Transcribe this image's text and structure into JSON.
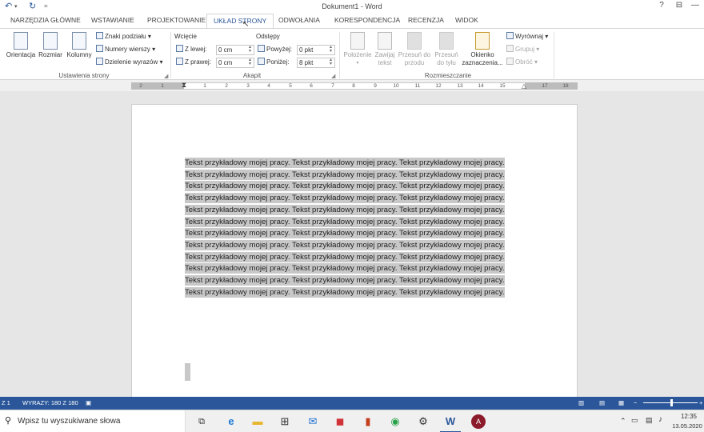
{
  "titlebar": {
    "title": "Dokument1 - Word",
    "undo_icon": "undo-icon",
    "redo_icon": "redo-icon",
    "qat_more": "=",
    "help": "?",
    "ribbon_display": "⊟",
    "minimize": "—"
  },
  "tabs": [
    {
      "label": "NARZĘDZIA GŁÓWNE"
    },
    {
      "label": "WSTAWIANIE"
    },
    {
      "label": "PROJEKTOWANIE"
    },
    {
      "label": "UKŁAD STRONY",
      "active": true
    },
    {
      "label": "ODWOŁANIA"
    },
    {
      "label": "KORESPONDENCJA"
    },
    {
      "label": "RECENZJA"
    },
    {
      "label": "WIDOK"
    }
  ],
  "ribbon": {
    "page_setup": {
      "orientation": "Orientacja",
      "size": "Rozmiar",
      "columns": "Kolumny",
      "breaks": "Znaki podziału",
      "line_numbers": "Numery wierszy",
      "hyphenation": "Dzielenie wyrazów",
      "group_label": "Ustawienia strony"
    },
    "paragraph": {
      "indent_title": "Wcięcie",
      "spacing_title": "Odstępy",
      "left_label": "Z lewej:",
      "left_value": "0 cm",
      "right_label": "Z prawej:",
      "right_value": "0 cm",
      "before_label": "Powyżej:",
      "before_value": "0 pkt",
      "after_label": "Poniżej:",
      "after_value": "8 pkt",
      "group_label": "Akapit"
    },
    "arrange": {
      "position": "Położenie",
      "wrap_text_1": "Zawijaj",
      "wrap_text_2": "tekst",
      "bring_forward_1": "Przesuń do",
      "bring_forward_2": "przodu",
      "send_backward_1": "Przesuń",
      "send_backward_2": "do tyłu",
      "selection_pane_1": "Okienko",
      "selection_pane_2": "zaznaczenia...",
      "align": "Wyrównaj",
      "group": "Grupuj",
      "rotate": "Obróć",
      "group_label": "Rozmieszczanie"
    }
  },
  "ruler": {
    "ticks": [
      "2",
      "1",
      "1",
      "2",
      "3",
      "4",
      "5",
      "6",
      "7",
      "8",
      "9",
      "10",
      "11",
      "12",
      "13",
      "14",
      "15",
      "16",
      "17",
      "18"
    ]
  },
  "document": {
    "text": "Tekst przykładowy mojej pracy. Tekst przykładowy mojej pracy. Tekst przykładowy mojej pracy. Tekst przykładowy mojej pracy. Tekst przykładowy mojej pracy. Tekst przykładowy mojej pracy. Tekst przykładowy mojej pracy. Tekst przykładowy mojej pracy. Tekst przykładowy mojej pracy. Tekst przykładowy mojej pracy. Tekst przykładowy mojej pracy. Tekst przykładowy mojej pracy. Tekst przykładowy mojej pracy. Tekst przykładowy mojej pracy. Tekst przykładowy mojej pracy. Tekst przykładowy mojej pracy. Tekst przykładowy mojej pracy. Tekst przykładowy mojej pracy. Tekst przykładowy mojej pracy. Tekst przykładowy mojej pracy. Tekst przykładowy mojej pracy. Tekst przykładowy mojej pracy. Tekst przykładowy mojej pracy. Tekst przykładowy mojej pracy. Tekst przykładowy mojej pracy. Tekst przykładowy mojej pracy. Tekst przykładowy mojej pracy. Tekst przykładowy mojej pracy. Tekst przykładowy mojej pracy. Tekst przykładowy mojej pracy. Tekst przykładowy mojej pracy. Tekst przykładowy mojej pracy. Tekst przykładowy mojej pracy. Tekst przykładowy mojej pracy. Tekst przykładowy mojej pracy. Tekst przykładowy mojej pracy."
  },
  "statusbar": {
    "page": "Z 1",
    "words": "WYRAZY: 180 Z 180"
  },
  "taskbar": {
    "search_placeholder": "Wpisz tu wyszukiwane słowa",
    "time": "12:35",
    "date": "13.05.2020"
  },
  "colors": {
    "accent": "#2b579a",
    "selection": "#c8c8c8"
  }
}
